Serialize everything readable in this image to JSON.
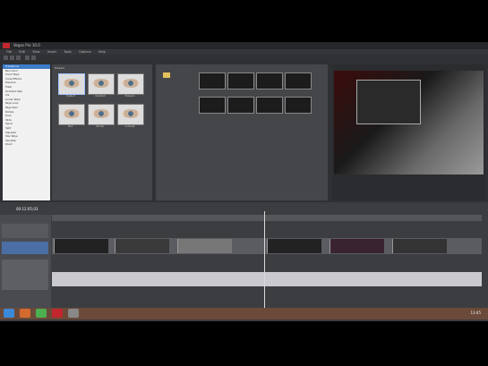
{
  "window": {
    "title": "Vegas Pro 10.0",
    "accent": "#c1272d"
  },
  "menu": [
    "File",
    "Edit",
    "View",
    "Insert",
    "Tools",
    "Options",
    "Help"
  ],
  "explorer": {
    "tree_items": [
      "Transitions",
      "Barn Door",
      "Clock Wipe",
      "Cross Effects",
      "Dissolve",
      "Flash",
      "Gradient Map",
      "Iris",
      "Linear Wipe",
      "Page Loop",
      "Page Peel",
      "Portals",
      "Push",
      "Slide",
      "Spiral",
      "Split",
      "Squeeze",
      "Star Wipe",
      "Venetian",
      "Zoom"
    ],
    "selected_index": 0
  },
  "effects": {
    "header": "Presets",
    "items": [
      "Default",
      "Gradient",
      "Sharpen",
      "Blur",
      "Border",
      "Contrast"
    ]
  },
  "timeline": {
    "timecode": "00:12:05;03",
    "zoom_label": "Rate: 0.00"
  },
  "taskbar": {
    "clock": "13:45"
  }
}
